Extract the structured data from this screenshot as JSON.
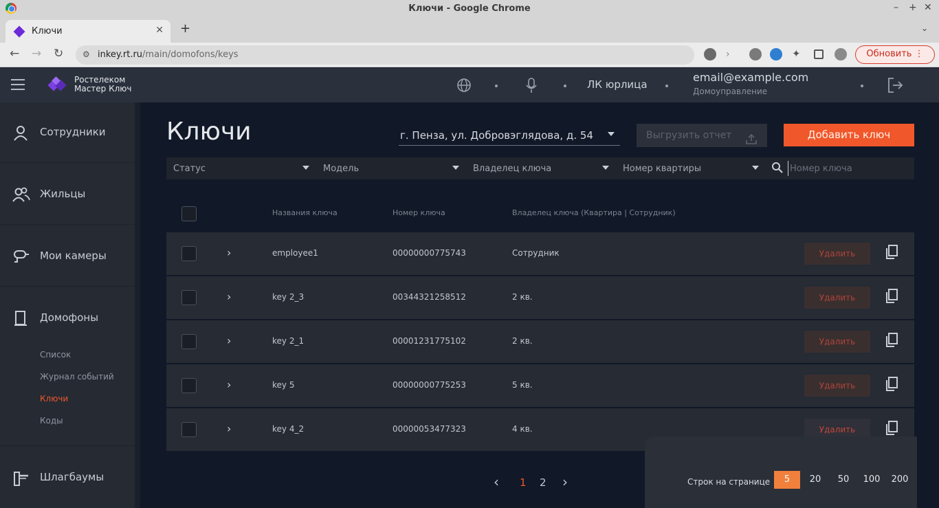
{
  "browser": {
    "window_title": "Ключи - Google Chrome",
    "tab_title": "Ключи",
    "url_host": "inkey.rt.ru",
    "url_path": "/main/domofons/keys",
    "update_label": "Обновить"
  },
  "header": {
    "logo_line1": "Ростелеком",
    "logo_line2": "Мастер Ключ",
    "account_type": "ЛК юрлица",
    "user_email": "email@example.com",
    "user_role": "Домоуправление"
  },
  "sidebar": {
    "items": [
      {
        "label": "Сотрудники",
        "icon": "person-icon"
      },
      {
        "label": "Жильцы",
        "icon": "people-icon"
      },
      {
        "label": "Мои камеры",
        "icon": "camera-icon"
      },
      {
        "label": "Домофоны",
        "icon": "intercom-icon"
      },
      {
        "label": "Шлагбаумы",
        "icon": "barrier-icon"
      }
    ],
    "subitems": [
      {
        "label": "Список",
        "active": false
      },
      {
        "label": "Журнал событий",
        "active": false
      },
      {
        "label": "Ключи",
        "active": true
      },
      {
        "label": "Коды",
        "active": false
      }
    ]
  },
  "main": {
    "title": "Ключи",
    "address": "г. Пенза, ул. Добровэглядова, д. 54",
    "export_label": "Выгрузить отчет",
    "add_label": "Добавить ключ",
    "filters": {
      "status": "Статус",
      "model": "Модель",
      "owner": "Владелец ключа",
      "apartment": "Номер квартиры",
      "search_placeholder": "Номер ключа"
    },
    "columns": {
      "name": "Названия ключа",
      "number": "Номер ключа",
      "owner": "Владелец ключа (Квартира | Сотрудник)"
    },
    "rows": [
      {
        "name": "employee1",
        "number": "00000000775743",
        "owner": "Сотрудник",
        "delete_label": "Удалить"
      },
      {
        "name": "key 2_3",
        "number": "00344321258512",
        "owner": "2 кв.",
        "delete_label": "Удалить"
      },
      {
        "name": "key 2_1",
        "number": "00001231775102",
        "owner": "2 кв.",
        "delete_label": "Удалить"
      },
      {
        "name": "key 5",
        "number": "00000000775253",
        "owner": "5 кв.",
        "delete_label": "Удалить"
      },
      {
        "name": "key 4_2",
        "number": "00000053477323",
        "owner": "4 кв.",
        "delete_label": "Удалить"
      }
    ],
    "pagination": {
      "pages": [
        "1",
        "2"
      ],
      "current": "1"
    },
    "rows_per_page": {
      "label": "Строк на странице",
      "options": [
        "5",
        "20",
        "50",
        "100",
        "200"
      ],
      "selected": "5"
    }
  },
  "colors": {
    "accent": "#f0572a",
    "panel": "#262b34",
    "background": "#111827"
  }
}
